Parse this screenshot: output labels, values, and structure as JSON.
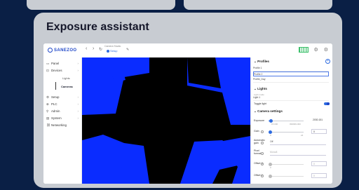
{
  "card": {
    "title": "Exposure assistant"
  },
  "app": {
    "logo": "SANEZOO",
    "camera_name": "Camera Studio",
    "status": "Setup",
    "icons": {
      "back": "‹",
      "forward": "›",
      "refresh": "↻",
      "edit": "✎",
      "settings": "⚙"
    }
  },
  "sidebar": {
    "items": [
      {
        "label": "Panel",
        "icon": "▭"
      },
      {
        "label": "Devices",
        "icon": "⊡"
      },
      {
        "label": "Setup",
        "icon": "⚙"
      },
      {
        "label": "PLC",
        "icon": "⊕"
      },
      {
        "label": "Admin",
        "icon": "⚲"
      },
      {
        "label": "System",
        "icon": "▤"
      },
      {
        "label": "Networking",
        "icon": "⛓"
      }
    ],
    "sub": {
      "lights": "Lights",
      "cameras": "Cameras"
    }
  },
  "panel": {
    "profiles_title": "Profiles",
    "profiles": [
      "Profile 1",
      "Profile 2",
      "Profile_Day"
    ],
    "lights_title": "Lights",
    "light_field_label": "Light mode",
    "light_field_value": "Light 1",
    "trigger_label": "Toggle light",
    "camera_title": "Camera settings",
    "exposure": {
      "label": "Exposure",
      "value": "2030.151",
      "min_label": "15.000",
      "max_label": "999999.000"
    },
    "gain": {
      "label": "Gain",
      "value": "0",
      "min_label": "0",
      "max_label": "24"
    },
    "auto_gain": {
      "label": "Automatic gain",
      "value": "Off"
    },
    "pixel_format": {
      "label": "Pixel format",
      "value": "Mono8"
    },
    "offset_x": {
      "label": "Offset X",
      "value": "0",
      "min_label": "0"
    },
    "offset_y": {
      "label": "Offset Y",
      "value": "0"
    }
  },
  "colors": {
    "viewer_shape": "#0a2cff",
    "viewer_bg": "#000000",
    "accent": "#2d6be0"
  }
}
